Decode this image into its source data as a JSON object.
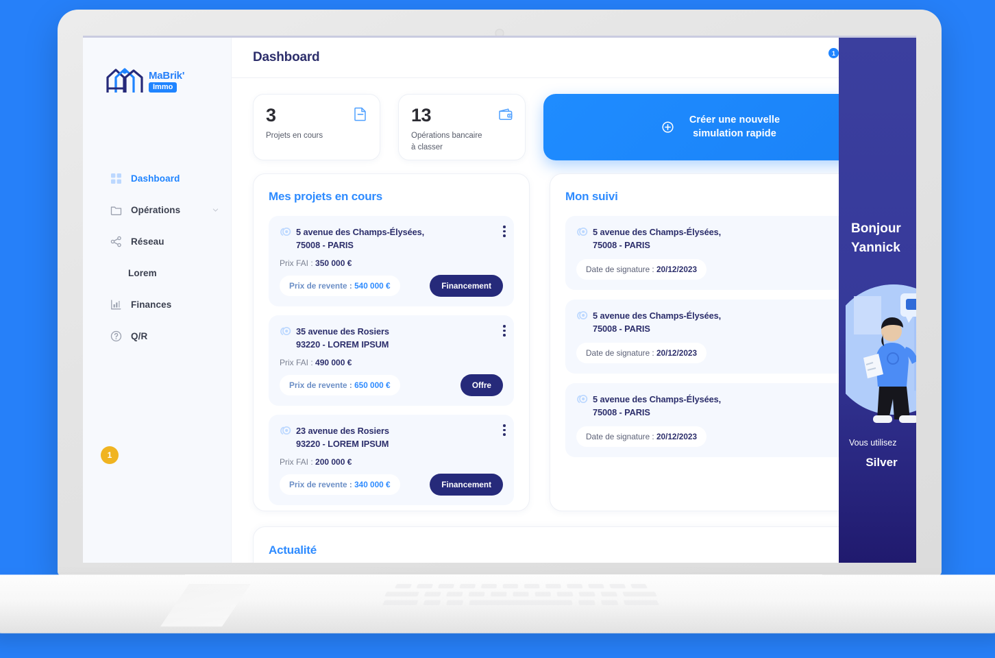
{
  "sidebar": {
    "logo": {
      "word": "MaBrik'",
      "badge": "Immo",
      "icon": "house-logo-icon"
    },
    "items": [
      {
        "label": "Dashboard",
        "icon": "grid-icon",
        "active": true,
        "chevron": false
      },
      {
        "label": "Opérations",
        "icon": "folder-icon",
        "active": false,
        "chevron": true
      },
      {
        "label": "Réseau",
        "icon": "share-icon",
        "active": false,
        "chevron": false
      },
      {
        "label": "Lorem",
        "icon": "none",
        "active": false,
        "chevron": false,
        "sub": true
      },
      {
        "label": "Finances",
        "icon": "chart-bars-icon",
        "active": false,
        "chevron": false
      },
      {
        "label": "Q/R",
        "icon": "question-circle-icon",
        "active": false,
        "chevron": false
      }
    ],
    "badge_count": "1"
  },
  "topbar": {
    "title": "Dashboard",
    "notification_count": "1",
    "bell_icon": "bell-icon",
    "avatar_chevron": "chevron-down-icon"
  },
  "stats": [
    {
      "number": "3",
      "label": "Projets en cours",
      "icon": "document-minus-icon"
    },
    {
      "number": "13",
      "label": "Opérations bancaire\nà classer",
      "label_line1": "Opérations bancaire",
      "label_line2": "à classer",
      "icon": "wallet-icon"
    }
  ],
  "cta": {
    "line1": "Créer une nouvelle",
    "line2": "simulation rapide",
    "icon": "plus-circle-icon",
    "color": "#1f84ff"
  },
  "projects_panel": {
    "title": "Mes projets en cours",
    "cards": [
      {
        "address_line1": "5 avenue des Champs-Élysées,",
        "address_line2": "75008 - PARIS",
        "fai_label": "Prix FAI : ",
        "fai_value": "350 000 €",
        "resale_label": "Prix de revente : ",
        "resale_value": "540 000 €",
        "tag": "Financement"
      },
      {
        "address_line1": "35 avenue des Rosiers",
        "address_line2": "93220 - LOREM IPSUM",
        "fai_label": "Prix FAI : ",
        "fai_value": "490 000 €",
        "resale_label": "Prix de revente : ",
        "resale_value": "650 000 €",
        "tag": "Offre"
      },
      {
        "address_line1": "23 avenue des Rosiers",
        "address_line2": "93220 - LOREM IPSUM",
        "fai_label": "Prix FAI : ",
        "fai_value": "200 000 €",
        "resale_label": "Prix de revente : ",
        "resale_value": "340 000 €",
        "tag": "Financement"
      }
    ]
  },
  "suivi_panel": {
    "title": "Mon suivi",
    "cards": [
      {
        "address_line1": "5 avenue des Champs-Élysées,",
        "address_line2": "75008 - PARIS",
        "date_label": "Date de signature : ",
        "date_value": "20/12/2023"
      },
      {
        "address_line1": "5 avenue des Champs-Élysées,",
        "address_line2": "75008 - PARIS",
        "date_label": "Date de signature : ",
        "date_value": "20/12/2023"
      },
      {
        "address_line1": "5 avenue des Champs-Élysées,",
        "address_line2": "75008 - PARIS",
        "date_label": "Date de signature : ",
        "date_value": "20/12/2023"
      }
    ]
  },
  "news": {
    "title": "Actualité"
  },
  "promo": {
    "greeting_line1": "Bonjour",
    "greeting_line2": "Yannick",
    "footer_text": "Vous utilisez",
    "plan": "Silver",
    "illustration": "person-with-clipboard-illustration"
  },
  "colors": {
    "page_background": "#2680f9",
    "accent_blue": "#1f84ff",
    "deep_navy": "#262a7a",
    "sidebar_bg": "#f7f9fd",
    "badge_yellow": "#f0b421"
  }
}
